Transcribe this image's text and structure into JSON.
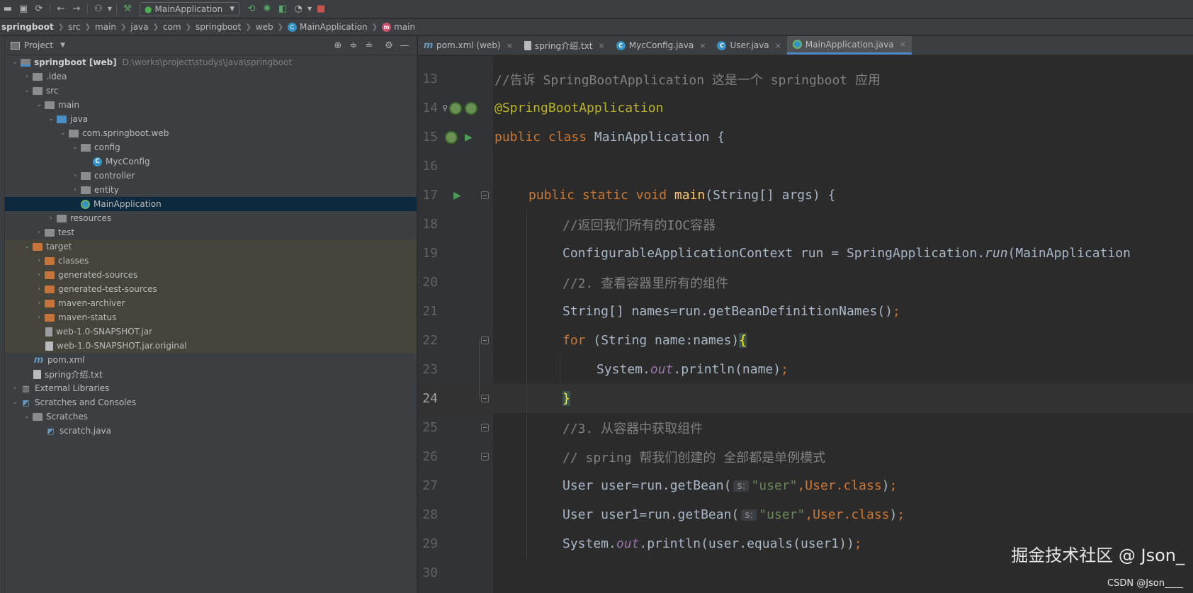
{
  "toolbar": {
    "run_config": "MainApplication"
  },
  "breadcrumb": [
    "springboot",
    "src",
    "main",
    "java",
    "com",
    "springboot",
    "web",
    "MainApplication",
    "main"
  ],
  "project_panel": {
    "title": "Project",
    "tree": [
      {
        "label": "springboot [web]",
        "path": "D:\\works\\project\\studys\\java\\springboot"
      },
      {
        "label": ".idea"
      },
      {
        "label": "src"
      },
      {
        "label": "main"
      },
      {
        "label": "java"
      },
      {
        "label": "com.springboot.web"
      },
      {
        "label": "config"
      },
      {
        "label": "MycConfig"
      },
      {
        "label": "controller"
      },
      {
        "label": "entity"
      },
      {
        "label": "MainApplication"
      },
      {
        "label": "resources"
      },
      {
        "label": "test"
      },
      {
        "label": "target"
      },
      {
        "label": "classes"
      },
      {
        "label": "generated-sources"
      },
      {
        "label": "generated-test-sources"
      },
      {
        "label": "maven-archiver"
      },
      {
        "label": "maven-status"
      },
      {
        "label": "web-1.0-SNAPSHOT.jar"
      },
      {
        "label": "web-1.0-SNAPSHOT.jar.original"
      },
      {
        "label": "pom.xml"
      },
      {
        "label": "spring介绍.txt"
      },
      {
        "label": "External Libraries"
      },
      {
        "label": "Scratches and Consoles"
      },
      {
        "label": "Scratches"
      },
      {
        "label": "scratch.java"
      }
    ]
  },
  "tabs": [
    {
      "label": "pom.xml (web)"
    },
    {
      "label": "spring介绍.txt"
    },
    {
      "label": "MycConfig.java"
    },
    {
      "label": "User.java"
    },
    {
      "label": "MainApplication.java"
    }
  ],
  "editor": {
    "line_numbers": [
      "13",
      "14",
      "15",
      "16",
      "17",
      "18",
      "19",
      "20",
      "21",
      "22",
      "23",
      "24",
      "25",
      "26",
      "27",
      "28",
      "29",
      "30"
    ],
    "current_line": "24",
    "code": {
      "l13": "//告诉 SpringBootApplication 这是一个 springboot 应用",
      "l14": "@SpringBootApplication",
      "l15_kw": "public class ",
      "l15_rest": "MainApplication {",
      "l17_kw": "public static void ",
      "l17_fn": "main",
      "l17_rest": "(String[] args) {",
      "l18": "//返回我们所有的IOC容器",
      "l19_a": "ConfigurableApplicationContext run = SpringApplication.",
      "l19_b": "run",
      "l19_c": "(MainApplication",
      "l20": "//2. 查看容器里所有的组件",
      "l21_a": "String[] names=run.getBeanDefinitionNames()",
      "l21_semi": ";",
      "l22_kw": "for ",
      "l22_rest": "(String name:names)",
      "l22_brace": "{",
      "l23_a": "System.",
      "l23_b": "out",
      "l23_c": ".println(name)",
      "l23_semi": ";",
      "l24": "}",
      "l25": "//3. 从容器中获取组件",
      "l26": "// spring 帮我们创建的 全部都是单例模式",
      "l27_a": "User user=run.getBean(",
      "l27_hint": "s:",
      "l27_str": "\"user\"",
      "l27_b": ",User.",
      "l27_kw": "class",
      "l27_c": ")",
      "l27_semi": ";",
      "l28_a": "User user1=run.getBean(",
      "l28_hint": "s:",
      "l28_str": "\"user\"",
      "l28_b": ",User.",
      "l28_kw": "class",
      "l28_c": ")",
      "l28_semi": ";",
      "l29_a": "System.",
      "l29_b": "out",
      "l29_c": ".println(user.equals(user1))",
      "l29_semi": ";"
    }
  },
  "watermark": {
    "main": "掘金技术社区 @ Json_",
    "sub": "CSDN @Json____"
  }
}
